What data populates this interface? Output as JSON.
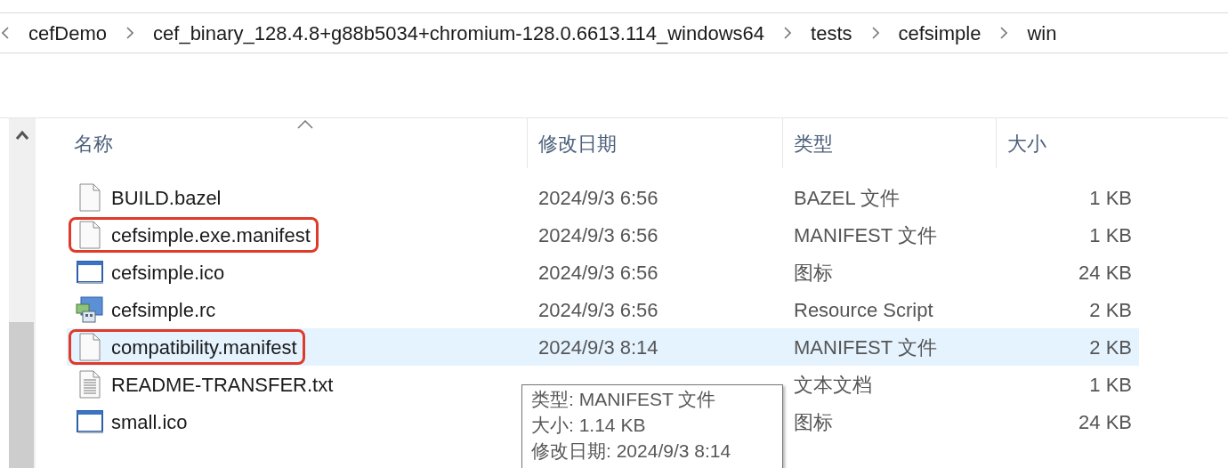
{
  "breadcrumb": [
    "cefDemo",
    "cef_binary_128.4.8+g88b5034+chromium-128.0.6613.114_windows64",
    "tests",
    "cefsimple",
    "win"
  ],
  "columns": [
    {
      "label": "名称",
      "sorted": true
    },
    {
      "label": "修改日期",
      "sorted": false
    },
    {
      "label": "类型",
      "sorted": false
    },
    {
      "label": "大小",
      "sorted": false
    }
  ],
  "files": [
    {
      "kind": "file",
      "name": "BUILD.bazel",
      "date": "2024/9/3 6:56",
      "type": "BAZEL 文件",
      "size": "1 KB",
      "selected": false,
      "annotated": false
    },
    {
      "kind": "file",
      "name": "cefsimple.exe.manifest",
      "date": "2024/9/3 6:56",
      "type": "MANIFEST 文件",
      "size": "1 KB",
      "selected": false,
      "annotated": true
    },
    {
      "kind": "ico",
      "name": "cefsimple.ico",
      "date": "2024/9/3 6:56",
      "type": "图标",
      "size": "24 KB",
      "selected": false,
      "annotated": false
    },
    {
      "kind": "rc",
      "name": "cefsimple.rc",
      "date": "2024/9/3 6:56",
      "type": "Resource Script",
      "size": "2 KB",
      "selected": false,
      "annotated": false
    },
    {
      "kind": "file",
      "name": "compatibility.manifest",
      "date": "2024/9/3 8:14",
      "type": "MANIFEST 文件",
      "size": "2 KB",
      "selected": true,
      "annotated": true
    },
    {
      "kind": "txt",
      "name": "README-TRANSFER.txt",
      "type": "文本文档",
      "size": "1 KB",
      "selected": false,
      "annotated": false
    },
    {
      "kind": "ico",
      "name": "small.ico",
      "type": "图标",
      "size": "24 KB",
      "selected": false,
      "annotated": false
    }
  ],
  "tooltip": [
    "类型: MANIFEST 文件",
    "大小: 1.14 KB",
    "修改日期: 2024/9/3 8:14"
  ]
}
